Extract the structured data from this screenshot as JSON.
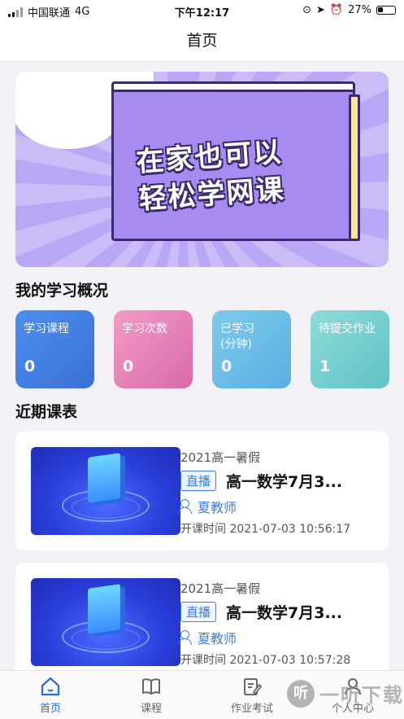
{
  "status_bar": {
    "carrier": "中国联通",
    "network": "4G",
    "time": "下午12:17",
    "battery": "27%"
  },
  "nav": {
    "title": "首页"
  },
  "banner": {
    "line1": "在家也可以",
    "line2": "轻松学网课"
  },
  "overview": {
    "title": "我的学习概况",
    "cards": [
      {
        "label": "学习课程",
        "value": "0",
        "color": "#4e8ff0"
      },
      {
        "label": "学习次数",
        "value": "0",
        "color": "#f39bc6"
      },
      {
        "label": "已学习\n(分钟)",
        "value": "0",
        "color": "#7ecbed"
      },
      {
        "label": "待提交作业",
        "value": "1",
        "color": "#8fdbd9"
      }
    ]
  },
  "schedule": {
    "title": "近期课表",
    "courses": [
      {
        "term": "2021高一暑假",
        "badge": "直播",
        "title": "高一数学7月3...",
        "teacher": "夏教师",
        "time": "开课时间 2021-07-03 10:56:17"
      },
      {
        "term": "2021高一暑假",
        "badge": "直播",
        "title": "高一数学7月3...",
        "teacher": "夏教师",
        "time": "开课时间 2021-07-03 10:57:28"
      }
    ]
  },
  "tabbar": {
    "items": [
      {
        "label": "首页",
        "icon": "home-icon",
        "active": true
      },
      {
        "label": "课程",
        "icon": "book-icon",
        "active": false
      },
      {
        "label": "作业考试",
        "icon": "edit-icon",
        "active": false
      },
      {
        "label": "个人中心",
        "icon": "user-icon",
        "active": false
      }
    ]
  },
  "watermark": {
    "mark": "听",
    "text": "一听下载"
  },
  "colors": {
    "accent": "#2b6be0",
    "live_badge": "#3c7fe0"
  }
}
